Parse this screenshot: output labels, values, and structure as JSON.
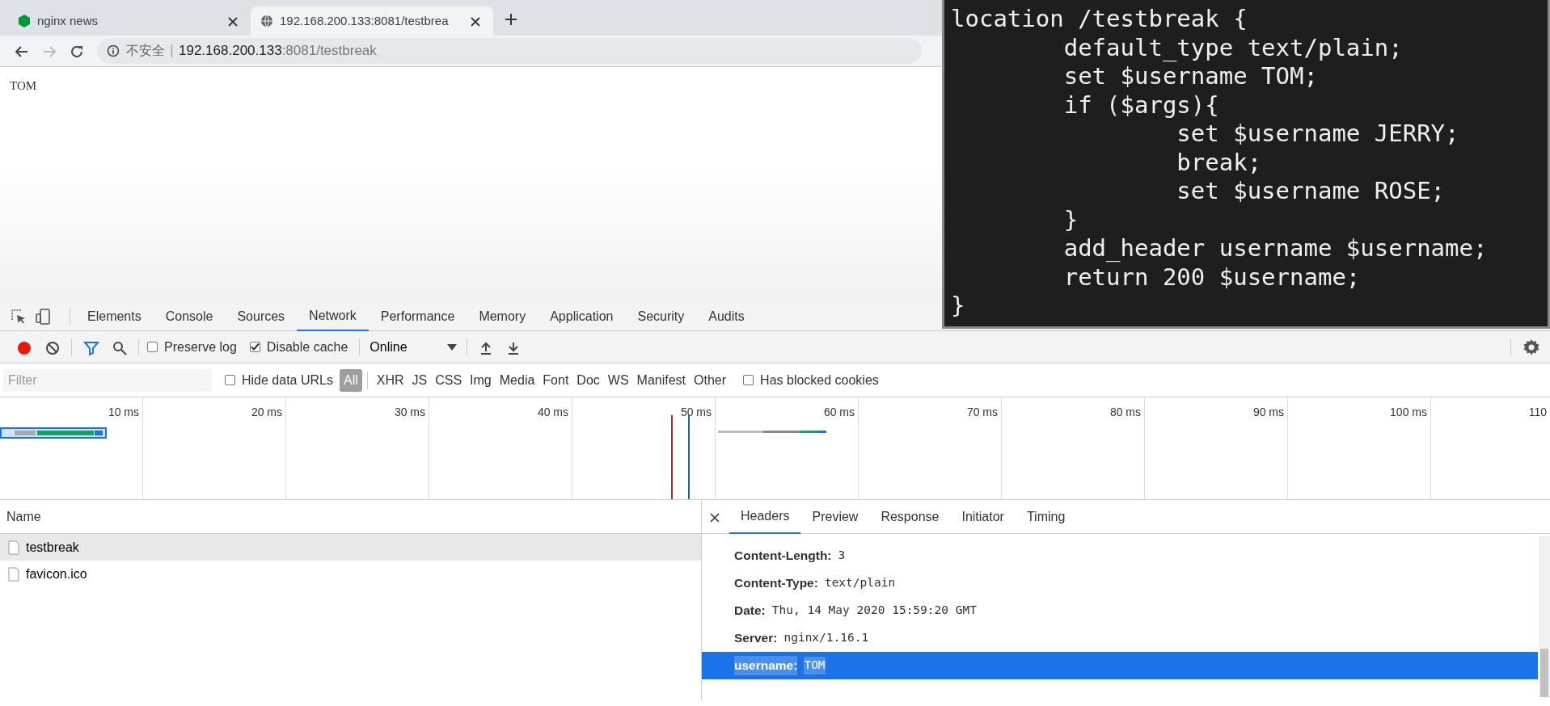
{
  "browser": {
    "tabs": [
      {
        "title": "nginx news",
        "selected": false
      },
      {
        "title": "192.168.200.133:8081/testbrea",
        "selected": true
      }
    ],
    "nav": {
      "back_disabled": false,
      "forward_disabled": true
    },
    "address": {
      "security": "不安全",
      "host": "192.168.200.133",
      "rest": ":8081/testbreak"
    },
    "page_text": "TOM"
  },
  "code_overlay": {
    "lines": [
      "location /testbreak {",
      "        default_type text/plain;",
      "        set $username TOM;",
      "        if ($args){",
      "                set $username JERRY;",
      "                break;",
      "                set $username ROSE;",
      "        }",
      "        add_header username $username;",
      "        return 200 $username;",
      "}"
    ]
  },
  "devtools": {
    "panel_tabs": [
      {
        "label": "Elements",
        "selected": false
      },
      {
        "label": "Console",
        "selected": false
      },
      {
        "label": "Sources",
        "selected": false
      },
      {
        "label": "Network",
        "selected": true
      },
      {
        "label": "Performance",
        "selected": false
      },
      {
        "label": "Memory",
        "selected": false
      },
      {
        "label": "Application",
        "selected": false
      },
      {
        "label": "Security",
        "selected": false
      },
      {
        "label": "Audits",
        "selected": false
      }
    ],
    "toolbar": {
      "recording": true,
      "filter_active": true,
      "preserve_log": {
        "label": "Preserve log",
        "checked": false
      },
      "disable_cache": {
        "label": "Disable cache",
        "checked": true
      },
      "throttling": "Online"
    },
    "filter_bar": {
      "placeholder": "Filter",
      "hide_data_urls": {
        "label": "Hide data URLs",
        "checked": false
      },
      "types": [
        {
          "label": "All",
          "selected": true
        },
        {
          "label": "XHR",
          "selected": false
        },
        {
          "label": "JS",
          "selected": false
        },
        {
          "label": "CSS",
          "selected": false
        },
        {
          "label": "Img",
          "selected": false
        },
        {
          "label": "Media",
          "selected": false
        },
        {
          "label": "Font",
          "selected": false
        },
        {
          "label": "Doc",
          "selected": false
        },
        {
          "label": "WS",
          "selected": false
        },
        {
          "label": "Manifest",
          "selected": false
        },
        {
          "label": "Other",
          "selected": false
        }
      ],
      "has_blocked_cookies": {
        "label": "Has blocked cookies",
        "checked": false
      }
    },
    "timeline": {
      "ticks": [
        "10 ms",
        "20 ms",
        "30 ms",
        "40 ms",
        "50 ms",
        "60 ms",
        "70 ms",
        "80 ms",
        "90 ms",
        "100 ms",
        "110"
      ]
    },
    "requests": {
      "column": "Name",
      "rows": [
        {
          "name": "testbreak",
          "selected": true
        },
        {
          "name": "favicon.ico",
          "selected": false
        }
      ]
    },
    "details": {
      "tabs": [
        {
          "label": "Headers",
          "selected": true
        },
        {
          "label": "Preview",
          "selected": false
        },
        {
          "label": "Response",
          "selected": false
        },
        {
          "label": "Initiator",
          "selected": false
        },
        {
          "label": "Timing",
          "selected": false
        }
      ],
      "headers": [
        {
          "name": "Content-Length:",
          "value": "3",
          "selected": false
        },
        {
          "name": "Content-Type:",
          "value": "text/plain",
          "selected": false
        },
        {
          "name": "Date:",
          "value": "Thu, 14 May 2020 15:59:20 GMT",
          "selected": false
        },
        {
          "name": "Server:",
          "value": "nginx/1.16.1",
          "selected": false
        },
        {
          "name": "username:",
          "value": "TOM",
          "selected": true
        }
      ]
    }
  }
}
